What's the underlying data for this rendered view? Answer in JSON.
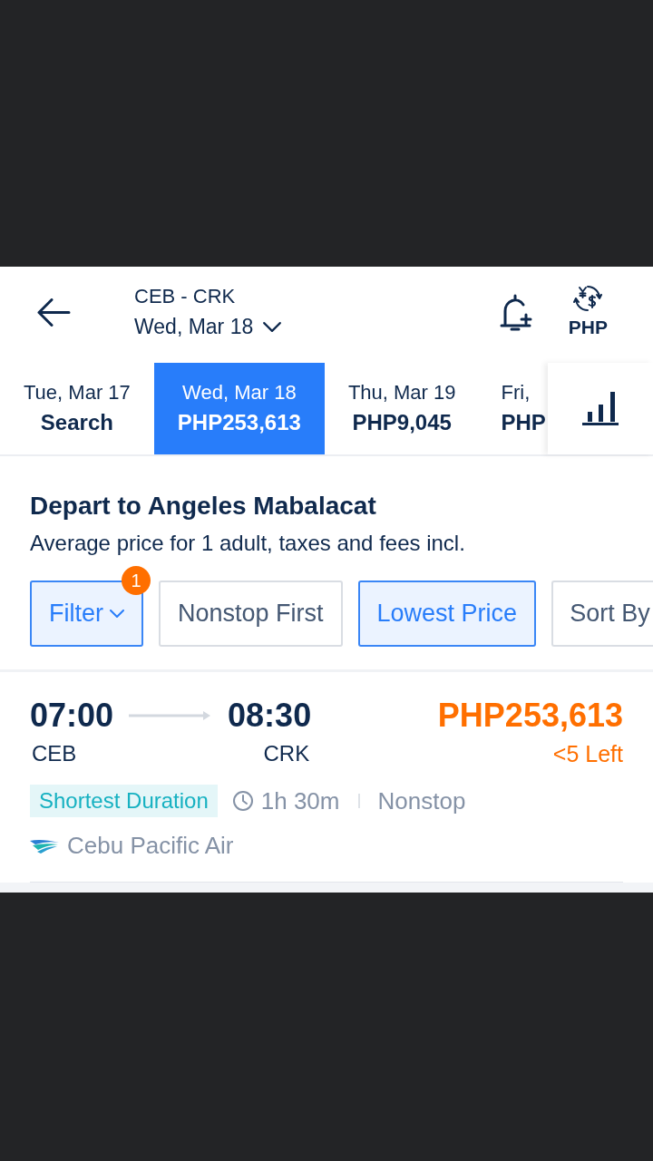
{
  "header": {
    "route": "CEB - CRK",
    "date": "Wed, Mar 18",
    "currency": "PHP"
  },
  "date_tabs": [
    {
      "date": "Tue, Mar 17",
      "price": "Search",
      "selected": false
    },
    {
      "date": "Wed, Mar 18",
      "price": "PHP253,613",
      "selected": true
    },
    {
      "date": "Thu, Mar 19",
      "price": "PHP9,045",
      "selected": false
    },
    {
      "date": "Fri,",
      "price": "PHP",
      "selected": false
    }
  ],
  "section": {
    "title": "Depart to Angeles Mabalacat",
    "subtitle": "Average price for 1 adult, taxes and fees incl."
  },
  "filters": [
    {
      "label": "Filter",
      "kind": "dropdown",
      "selected": true,
      "badge": "1"
    },
    {
      "label": "Nonstop First",
      "kind": "toggle",
      "selected": false
    },
    {
      "label": "Lowest Price",
      "kind": "toggle",
      "selected": true
    },
    {
      "label": "Sort By",
      "kind": "toggle",
      "selected": false
    }
  ],
  "flights": [
    {
      "depart_time": "07:00",
      "depart_airport": "CEB",
      "arrive_time": "08:30",
      "arrive_airport": "CRK",
      "price": "PHP253,613",
      "seats_left": "<5 Left",
      "tag": "Shortest Duration",
      "duration": "1h 30m",
      "stops": "Nonstop",
      "airline": "Cebu Pacific Air"
    }
  ]
}
